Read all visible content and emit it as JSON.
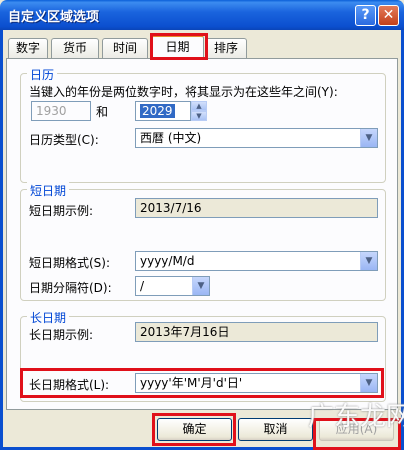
{
  "window": {
    "title": "自定义区域选项",
    "help_glyph": "?",
    "close_glyph": "✕"
  },
  "tabs": [
    {
      "label": "数字"
    },
    {
      "label": "货币"
    },
    {
      "label": "时间"
    },
    {
      "label": "日期"
    },
    {
      "label": "排序"
    }
  ],
  "active_tab": "日期",
  "calendar": {
    "group_title": "日历",
    "two_digit_year_text": "当键入的年份是两位数字时，将其显示为在这些年之间(Y):",
    "year_from": "1930",
    "and_label": "和",
    "year_to": "2029",
    "calendar_type_label": "日历类型(C):",
    "calendar_type_value": "西暦 (中文)"
  },
  "short_date": {
    "group_title": "短日期",
    "sample_label": "短日期示例:",
    "sample_value": "2013/7/16",
    "format_label": "短日期格式(S):",
    "format_value": "yyyy/M/d",
    "separator_label": "日期分隔符(D):",
    "separator_value": "/"
  },
  "long_date": {
    "group_title": "长日期",
    "sample_label": "长日期示例:",
    "sample_value": "2013年7月16日",
    "format_label": "长日期格式(L):",
    "format_value": "yyyy'年'M'月'd'日'"
  },
  "buttons": {
    "ok": "确定",
    "cancel": "取消",
    "apply": "应用(A)"
  },
  "watermark": "广东龙网",
  "colors": {
    "title_bar": "#0a4fcf",
    "highlight": "#e0101a",
    "group_title": "#0046d5",
    "dialog_bg": "#ece9d8"
  },
  "icons": {
    "dropdown": "▼",
    "spin_up": "▲",
    "spin_down": "▼"
  }
}
